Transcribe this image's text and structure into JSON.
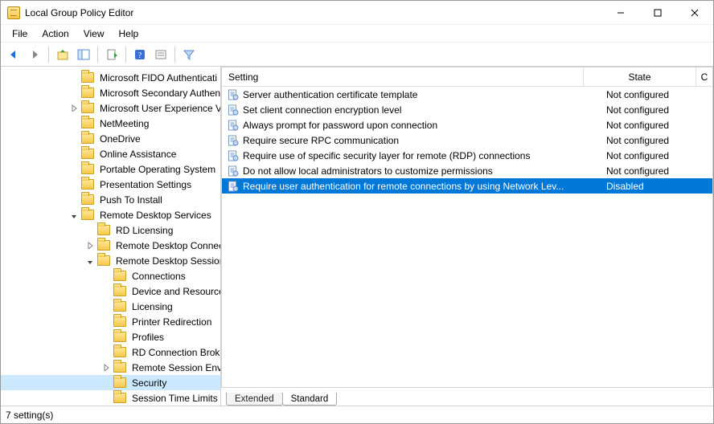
{
  "window": {
    "title": "Local Group Policy Editor"
  },
  "menus": {
    "file": "File",
    "action": "Action",
    "view": "View",
    "help": "Help"
  },
  "tree": {
    "items": [
      {
        "indent": 84,
        "exp": "",
        "label": "Microsoft FIDO Authenticati",
        "sel": false
      },
      {
        "indent": 84,
        "exp": "",
        "label": "Microsoft Secondary Authen",
        "sel": false
      },
      {
        "indent": 84,
        "exp": ">",
        "label": "Microsoft User Experience Vi",
        "sel": false
      },
      {
        "indent": 84,
        "exp": "",
        "label": "NetMeeting",
        "sel": false
      },
      {
        "indent": 84,
        "exp": "",
        "label": "OneDrive",
        "sel": false
      },
      {
        "indent": 84,
        "exp": "",
        "label": "Online Assistance",
        "sel": false
      },
      {
        "indent": 84,
        "exp": "",
        "label": "Portable Operating System",
        "sel": false
      },
      {
        "indent": 84,
        "exp": "",
        "label": "Presentation Settings",
        "sel": false
      },
      {
        "indent": 84,
        "exp": "",
        "label": "Push To Install",
        "sel": false
      },
      {
        "indent": 84,
        "exp": "v",
        "label": "Remote Desktop Services",
        "sel": false
      },
      {
        "indent": 104,
        "exp": "",
        "label": "RD Licensing",
        "sel": false
      },
      {
        "indent": 104,
        "exp": ">",
        "label": "Remote Desktop Connec",
        "sel": false
      },
      {
        "indent": 104,
        "exp": "v",
        "label": "Remote Desktop Session",
        "sel": false
      },
      {
        "indent": 124,
        "exp": "",
        "label": "Connections",
        "sel": false
      },
      {
        "indent": 124,
        "exp": "",
        "label": "Device and Resource",
        "sel": false
      },
      {
        "indent": 124,
        "exp": "",
        "label": "Licensing",
        "sel": false
      },
      {
        "indent": 124,
        "exp": "",
        "label": "Printer Redirection",
        "sel": false
      },
      {
        "indent": 124,
        "exp": "",
        "label": "Profiles",
        "sel": false
      },
      {
        "indent": 124,
        "exp": "",
        "label": "RD Connection Broke",
        "sel": false
      },
      {
        "indent": 124,
        "exp": ">",
        "label": "Remote Session Envir",
        "sel": false
      },
      {
        "indent": 124,
        "exp": "",
        "label": "Security",
        "sel": true
      },
      {
        "indent": 124,
        "exp": "",
        "label": "Session Time Limits",
        "sel": false
      }
    ]
  },
  "list": {
    "header": {
      "setting": "Setting",
      "state": "State",
      "last": "C"
    },
    "rows": [
      {
        "text": "Server authentication certificate template",
        "state": "Not configured",
        "sel": false
      },
      {
        "text": "Set client connection encryption level",
        "state": "Not configured",
        "sel": false
      },
      {
        "text": "Always prompt for password upon connection",
        "state": "Not configured",
        "sel": false
      },
      {
        "text": "Require secure RPC communication",
        "state": "Not configured",
        "sel": false
      },
      {
        "text": "Require use of specific security layer for remote (RDP) connections",
        "state": "Not configured",
        "sel": false
      },
      {
        "text": "Do not allow local administrators to customize permissions",
        "state": "Not configured",
        "sel": false
      },
      {
        "text": "Require user authentication for remote connections by using Network Lev...",
        "state": "Disabled",
        "sel": true
      }
    ]
  },
  "tabs": {
    "extended": "Extended",
    "standard": "Standard"
  },
  "status": {
    "text": "7 setting(s)"
  }
}
